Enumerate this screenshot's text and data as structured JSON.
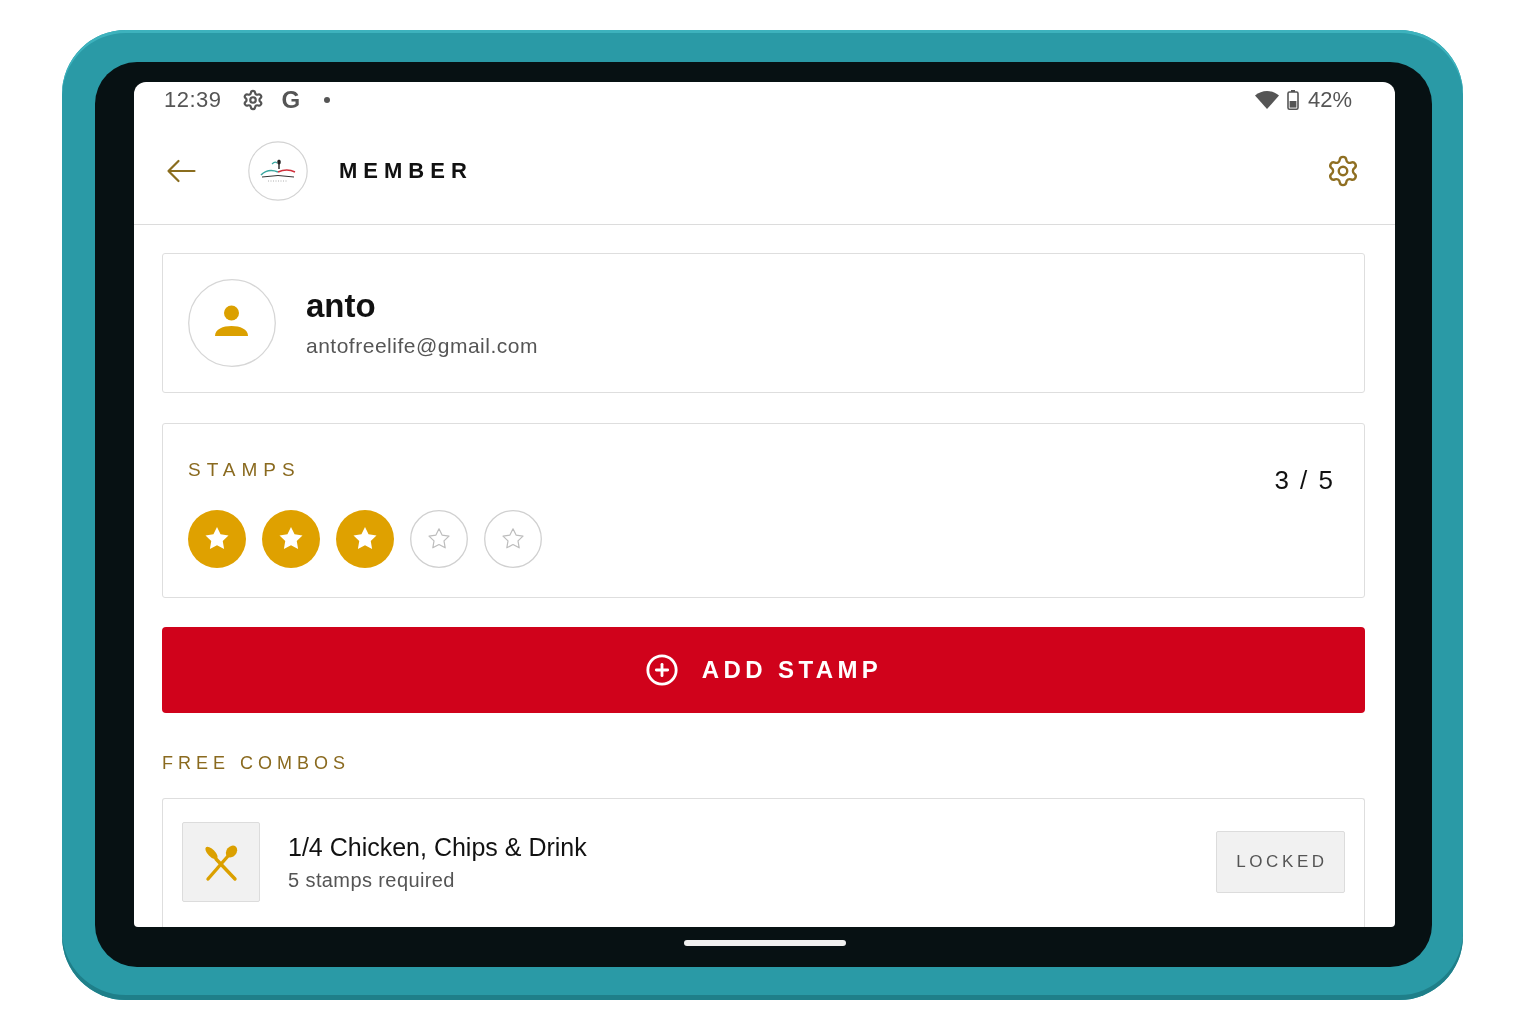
{
  "status_bar": {
    "time": "12:39",
    "notification_letter": "G",
    "battery": "42%"
  },
  "header": {
    "title": "MEMBER"
  },
  "member": {
    "name": "anto",
    "email": "antofreelife@gmail.com"
  },
  "stamps": {
    "label": "STAMPS",
    "count": "3 / 5",
    "slots": [
      {
        "filled": true
      },
      {
        "filled": true
      },
      {
        "filled": true
      },
      {
        "filled": false
      },
      {
        "filled": false
      }
    ]
  },
  "add_button": {
    "label": "ADD STAMP"
  },
  "free_combos": {
    "label": "FREE COMBOS",
    "items": [
      {
        "title": "1/4 Chicken, Chips & Drink",
        "requirement": "5 stamps required",
        "status": "LOCKED",
        "locked": true
      }
    ]
  }
}
